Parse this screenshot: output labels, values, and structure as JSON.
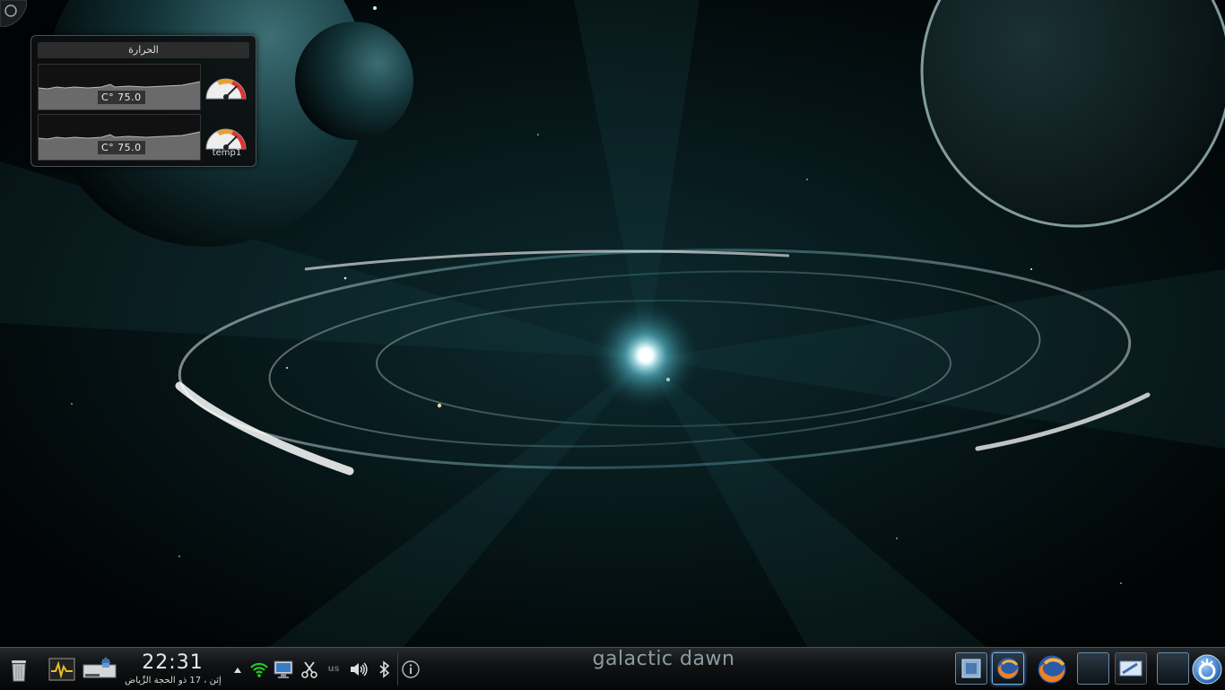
{
  "sensor_widget": {
    "title": "الحرارة",
    "sensors": [
      {
        "reading": "C° 75.0",
        "level": 0.75
      },
      {
        "reading": "C° 75.0",
        "level": 0.75
      }
    ],
    "sensor_label": "temp1"
  },
  "panel": {
    "clock_time": "22:31",
    "clock_date": "إثن ، 17 ذو الحجة الرِّياض",
    "keyboard_layout": "us",
    "wallpaper_text": "galactic dawn"
  },
  "icons": {
    "corner": "plasma-cashew-icon",
    "trash": "trash-icon",
    "system_monitor": "system-monitor-icon",
    "device_notifier": "device-notifier-icon",
    "tray_expand": "tray-expand-arrow-icon",
    "wifi": "wifi-icon",
    "network": "network-display-icon",
    "clipboard": "klipper-scissors-icon",
    "volume": "volume-icon",
    "bluetooth": "bluetooth-icon",
    "info": "notifications-info-icon",
    "firefox": "firefox-icon",
    "kickoff": "kde-kickoff-icon"
  },
  "colors": {
    "panel_bg": "#101214",
    "accent": "#7fb0e0",
    "wifi_green": "#22cc22"
  }
}
